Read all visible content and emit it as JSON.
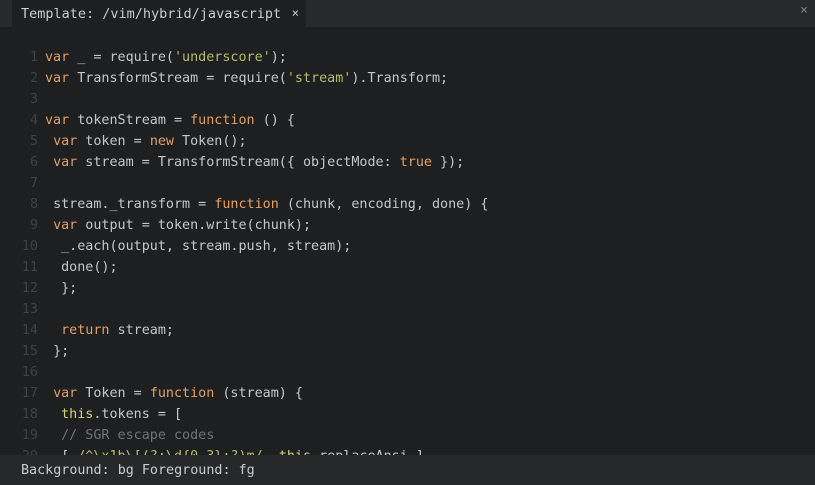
{
  "tab": {
    "title": "Template: /vim/hybrid/javascript",
    "close_glyph": "×"
  },
  "panel": {
    "close_glyph": "×"
  },
  "status": {
    "background_label": "Background: bg",
    "foreground_label": "Foreground: fg"
  },
  "colors": {
    "keyword": "#e3a063",
    "string": "#b7bd68",
    "comment": "#6f7478",
    "this": "#d6cf7a",
    "text": "#c5c8c6",
    "line_number": "#3f4244",
    "editor_bg": "#1d1f21"
  },
  "code_lines": [
    {
      "n": "1",
      "indent": "",
      "tokens": [
        [
          "kw",
          "var"
        ],
        [
          "plain",
          " _ = require("
        ],
        [
          "str",
          "'underscore'"
        ],
        [
          "plain",
          ");"
        ]
      ]
    },
    {
      "n": "2",
      "indent": "",
      "tokens": [
        [
          "kw",
          "var"
        ],
        [
          "plain",
          " TransformStream = require("
        ],
        [
          "str",
          "'stream'"
        ],
        [
          "plain",
          ").Transform;"
        ]
      ]
    },
    {
      "n": "3",
      "indent": "",
      "tokens": []
    },
    {
      "n": "4",
      "indent": "",
      "tokens": [
        [
          "kw",
          "var"
        ],
        [
          "plain",
          " tokenStream = "
        ],
        [
          "kw",
          "function"
        ],
        [
          "plain",
          " () {"
        ]
      ]
    },
    {
      "n": "5",
      "indent": " ",
      "tokens": [
        [
          "kw",
          "var"
        ],
        [
          "plain",
          " token = "
        ],
        [
          "kw",
          "new"
        ],
        [
          "plain",
          " Token();"
        ]
      ]
    },
    {
      "n": "6",
      "indent": " ",
      "tokens": [
        [
          "kw",
          "var"
        ],
        [
          "plain",
          " stream = TransformStream({ objectMode: "
        ],
        [
          "kw",
          "true"
        ],
        [
          "plain",
          " });"
        ]
      ]
    },
    {
      "n": "7",
      "indent": "",
      "tokens": []
    },
    {
      "n": "8",
      "indent": " ",
      "tokens": [
        [
          "plain",
          "stream._transform = "
        ],
        [
          "kw",
          "function"
        ],
        [
          "plain",
          " (chunk, encoding, done) {"
        ]
      ]
    },
    {
      "n": "9",
      "indent": " ",
      "tokens": [
        [
          "kw",
          "var"
        ],
        [
          "plain",
          " output = token.write(chunk);"
        ]
      ]
    },
    {
      "n": "10",
      "indent": "  ",
      "tokens": [
        [
          "plain",
          "_.each(output, stream.push, stream);"
        ]
      ]
    },
    {
      "n": "11",
      "indent": "  ",
      "tokens": [
        [
          "plain",
          "done();"
        ]
      ]
    },
    {
      "n": "12",
      "indent": "  ",
      "tokens": [
        [
          "plain",
          "};"
        ]
      ]
    },
    {
      "n": "13",
      "indent": "",
      "tokens": []
    },
    {
      "n": "14",
      "indent": "  ",
      "tokens": [
        [
          "kw",
          "return"
        ],
        [
          "plain",
          " stream;"
        ]
      ]
    },
    {
      "n": "15",
      "indent": " ",
      "tokens": [
        [
          "plain",
          "};"
        ]
      ]
    },
    {
      "n": "16",
      "indent": "",
      "tokens": []
    },
    {
      "n": "17",
      "indent": " ",
      "tokens": [
        [
          "kw",
          "var"
        ],
        [
          "plain",
          " Token = "
        ],
        [
          "kw",
          "function"
        ],
        [
          "plain",
          " (stream) {"
        ]
      ]
    },
    {
      "n": "18",
      "indent": "  ",
      "tokens": [
        [
          "this",
          "this"
        ],
        [
          "plain",
          ".tokens = ["
        ]
      ]
    },
    {
      "n": "19",
      "indent": "  ",
      "tokens": [
        [
          "com",
          "// SGR escape codes"
        ]
      ]
    },
    {
      "n": "20",
      "indent": "  ",
      "tokens": [
        [
          "plain",
          "[ "
        ],
        [
          "re",
          "/^\\x1b\\[(?:\\d{0,3};?)m/"
        ],
        [
          "plain",
          ", "
        ],
        [
          "this",
          "this"
        ],
        [
          "plain",
          ".replaceAnsi ]"
        ]
      ]
    }
  ]
}
